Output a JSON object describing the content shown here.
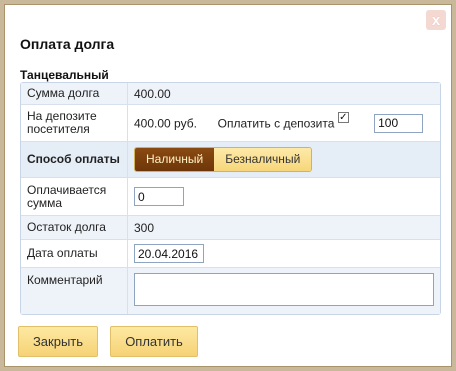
{
  "dialog": {
    "title": "Оплата долга",
    "close_label": "x"
  },
  "section_title": "Танцевальный",
  "rows": {
    "debt_amount": {
      "label": "Сумма долга",
      "value": "400.00"
    },
    "deposit": {
      "label": "На депозите посетителя",
      "value": "400.00 руб.",
      "pay_from_deposit_label": "Оплатить с депозита",
      "pay_from_deposit_checked": true,
      "deposit_amount": "100"
    },
    "payment_method": {
      "label": "Способ оплаты",
      "options": [
        "Наличный",
        "Безналичный"
      ],
      "selected": "Наличный"
    },
    "paid_amount": {
      "label": "Оплачивается сумма",
      "value": "0"
    },
    "remaining_debt": {
      "label": "Остаток долга",
      "value": "300"
    },
    "payment_date": {
      "label": "Дата оплаты",
      "value": "20.04.2016"
    },
    "comment": {
      "label": "Комментарий",
      "value": ""
    }
  },
  "buttons": {
    "close": "Закрыть",
    "pay": "Оплатить"
  },
  "colors": {
    "frame": "#c9b99a",
    "row_alt": "#eef3f9",
    "segment_active": "#7a3f0d",
    "button_bg": "#f8dc86"
  }
}
